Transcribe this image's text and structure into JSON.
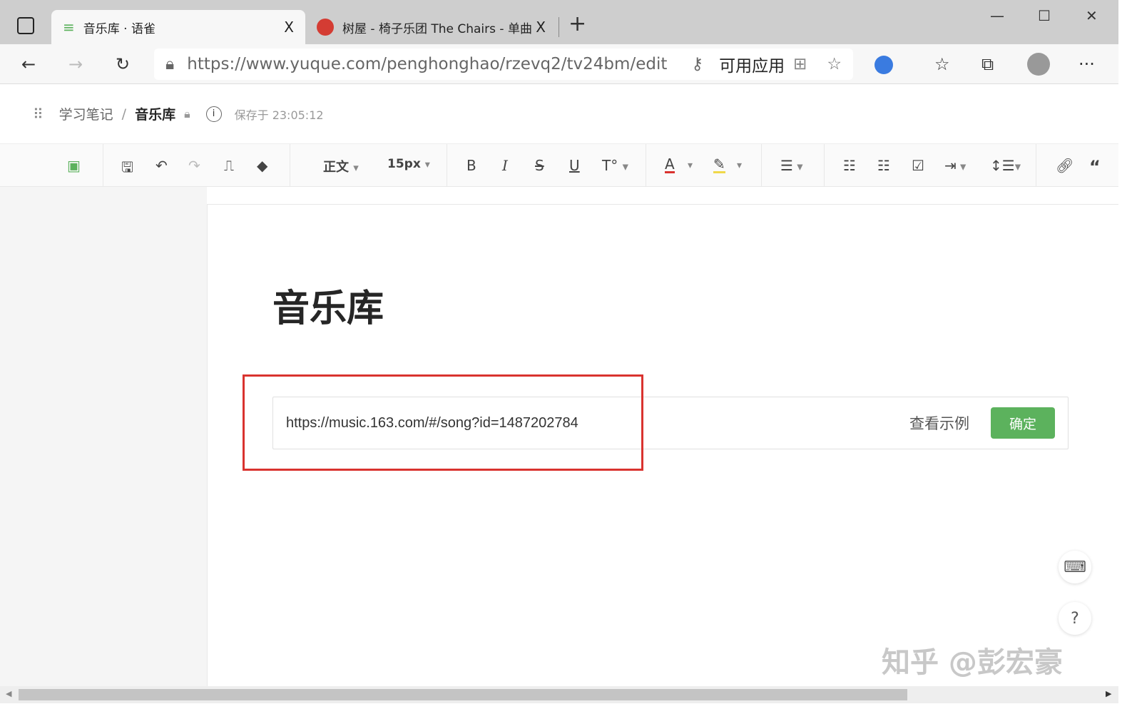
{
  "tabs": [
    {
      "label": "音乐库 · 语雀",
      "close": "X"
    },
    {
      "label": "树屋 - 椅子乐团 The Chairs - 单曲",
      "close": "X"
    }
  ],
  "new_tab": "+",
  "window": {
    "minimize": "—",
    "maximize": "☐",
    "close": "✕"
  },
  "address": {
    "url": "https://www.yuque.com/penghonghao/rzevq2/tv24bm/edit",
    "apps": "可用应用"
  },
  "breadcrumb": {
    "book": "学习笔记",
    "sep": "/",
    "doc": "音乐库",
    "saved": "保存于 23:05:12"
  },
  "toolbar": {
    "style": "正文",
    "size": "15px"
  },
  "doc": {
    "title": "音乐库"
  },
  "embed": {
    "value": "https://music.163.com/#/song?id=1487202784",
    "example": "查看示例",
    "confirm": "确定"
  },
  "watermark": "知乎 @彭宏豪",
  "colors": {
    "accent": "#5cb25d",
    "highlight_box": "#d9332f"
  }
}
